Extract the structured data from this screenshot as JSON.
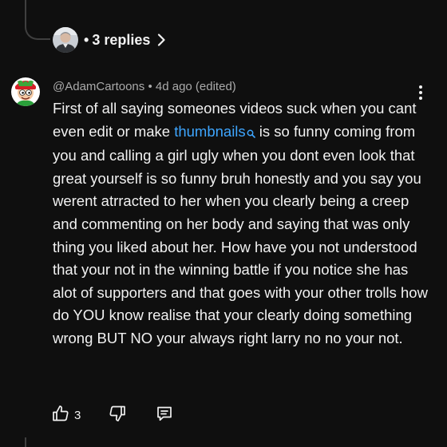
{
  "replies": {
    "dot": "•",
    "label": "3 replies"
  },
  "comment": {
    "author": "@AdamCartoons",
    "separator": " • ",
    "time": "4d ago (edited)",
    "text_before_link": "First of all saying someones videos suck when you cant even edit or make ",
    "link_text": "thumbnails",
    "text_after_link": " is so funny coming from you and calling a girl ugly when you dont even look that great yourself is so funny bruh honestly and you say you werent atrracted to her when you clearly being a creep and commenting on her body and saying that was only thing you liked about her. How have you not understood that your not in the winning battle if you notice she has alot of supporters and that goes with your other trolls how do YOU know realise that your clearly doing something wrong BUT NO your always right larry no no your not.",
    "likes": "3"
  },
  "icons": {
    "reply_chevron": "chevron-right-icon",
    "more": "more-vertical-icon",
    "search": "search-icon",
    "like": "thumb-up-icon",
    "dislike": "thumb-down-icon",
    "reply": "reply-comment-icon"
  },
  "colors": {
    "background": "#0f0f0f",
    "text": "#f1f1f1",
    "meta": "#aaaaaa",
    "link": "#3ea6ff",
    "thread_line": "#3f3f3f"
  }
}
